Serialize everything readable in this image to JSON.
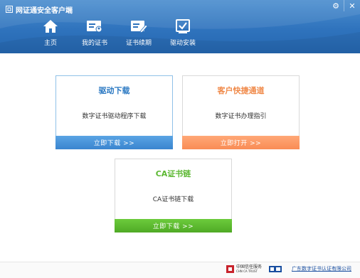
{
  "app": {
    "title": "网证通安全客户端"
  },
  "window_controls": {
    "settings_glyph": "⚙",
    "close_glyph": "✕"
  },
  "nav": {
    "items": [
      {
        "label": "主页",
        "icon": "home-icon"
      },
      {
        "label": "我的证书",
        "icon": "certificate-card-icon"
      },
      {
        "label": "证书续期",
        "icon": "certificate-renew-icon"
      },
      {
        "label": "驱动安装",
        "icon": "driver-install-icon"
      }
    ]
  },
  "cards": {
    "driver": {
      "title": "驱动下载",
      "description": "数字证书驱动程序下载",
      "button": "立即下载 >>",
      "accent": "#2a78c2"
    },
    "fast": {
      "title": "客户快捷通道",
      "description": "数字证书办理指引",
      "button": "立即打开 >>",
      "accent": "#f08a4a"
    },
    "ca": {
      "title": "CA证书链",
      "description": "CA证书链下载",
      "button": "立即下载 >>",
      "accent": "#5cb832"
    }
  },
  "footer": {
    "logo1_line1": "中国信任服务",
    "logo1_line2": "CHN CA TRUST",
    "logo2_line1": "CFCA",
    "logo3": "广东数字证书认证有限公司"
  },
  "colors": {
    "header": "#2f73bd",
    "blue_button": "#3a85cf",
    "orange_button": "#f98c55",
    "green_button": "#4faa25"
  }
}
